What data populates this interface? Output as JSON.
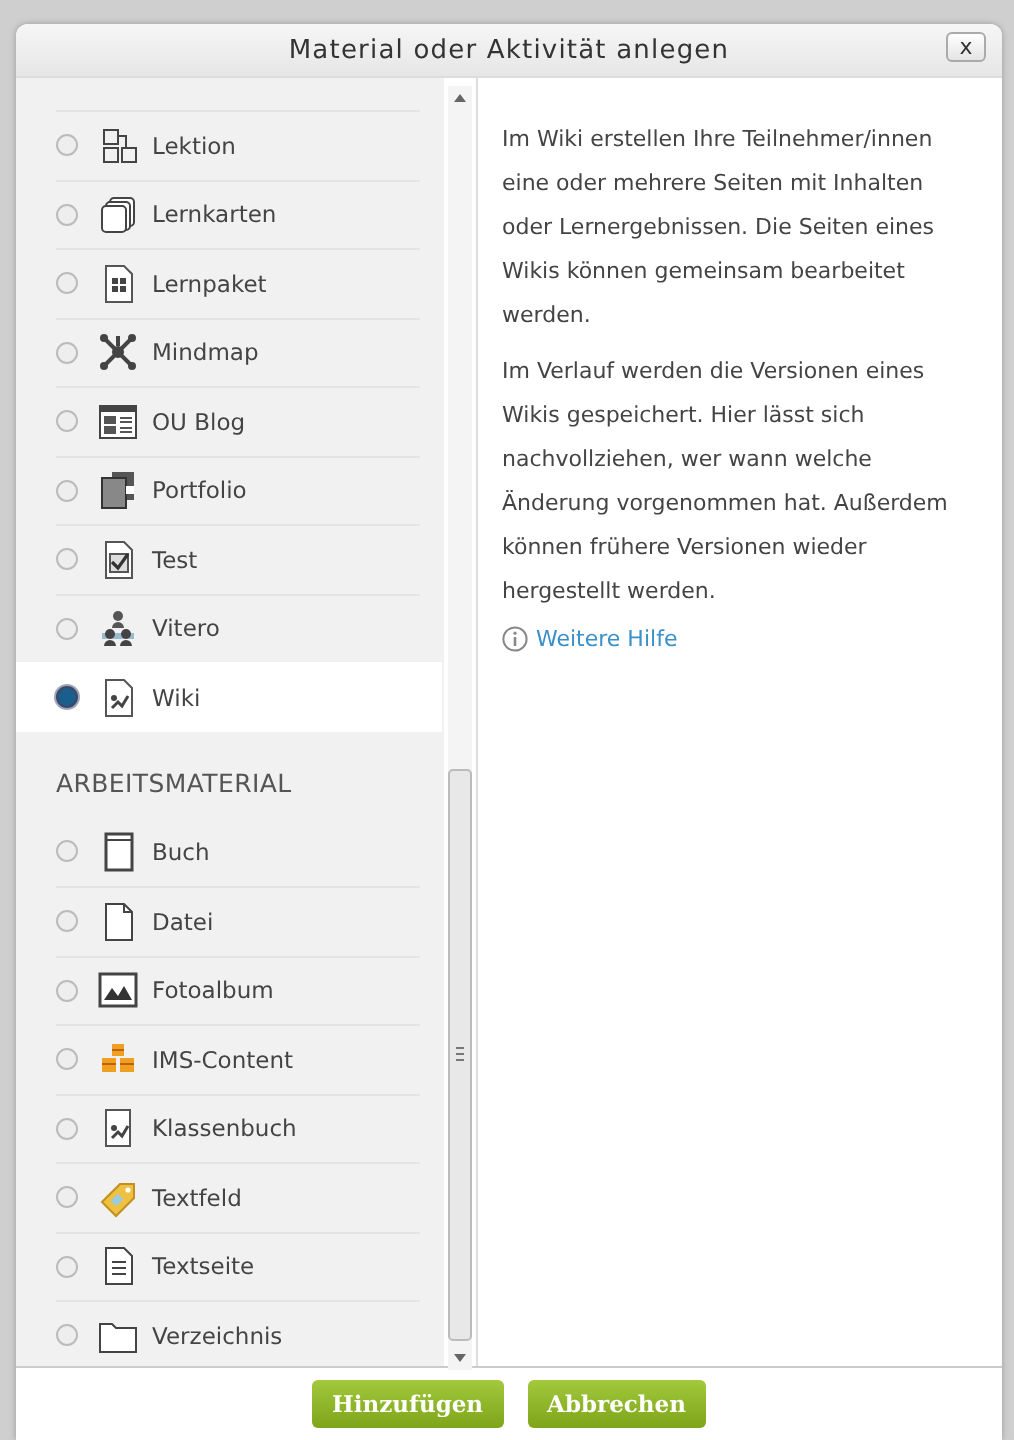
{
  "window": {
    "title": "Material oder Aktivität anlegen",
    "close": "x"
  },
  "sections": [
    {
      "items": [
        {
          "label": "Lektion",
          "selected": false
        },
        {
          "label": "Lernkarten",
          "selected": false
        },
        {
          "label": "Lernpaket",
          "selected": false
        },
        {
          "label": "Mindmap",
          "selected": false
        },
        {
          "label": "OU Blog",
          "selected": false
        },
        {
          "label": "Portfolio",
          "selected": false
        },
        {
          "label": "Test",
          "selected": false
        },
        {
          "label": "Vitero",
          "selected": false
        },
        {
          "label": "Wiki",
          "selected": true
        }
      ]
    },
    {
      "heading": "ARBEITSMATERIAL",
      "items": [
        {
          "label": "Buch",
          "selected": false
        },
        {
          "label": "Datei",
          "selected": false
        },
        {
          "label": "Fotoalbum",
          "selected": false
        },
        {
          "label": "IMS-Content",
          "selected": false
        },
        {
          "label": "Klassenbuch",
          "selected": false
        },
        {
          "label": "Textfeld",
          "selected": false
        },
        {
          "label": "Textseite",
          "selected": false
        },
        {
          "label": "Verzeichnis",
          "selected": false
        }
      ]
    }
  ],
  "description": {
    "paragraphs": [
      "Im Wiki erstellen Ihre Teilnehmer/innen eine oder mehrere Seiten mit Inhalten oder Lernergebnissen. Die Seiten eines Wikis können gemeinsam bearbeitet werden.",
      "Im Verlauf werden die Versionen eines Wikis gespeichert. Hier lässt sich nachvollziehen, wer wann welche Änderung vorgenommen hat. Außerdem können frühere Versionen wieder hergestellt werden."
    ],
    "help_link": "Weitere Hilfe"
  },
  "buttons": [
    "Hinzufügen",
    "Abbrechen"
  ]
}
